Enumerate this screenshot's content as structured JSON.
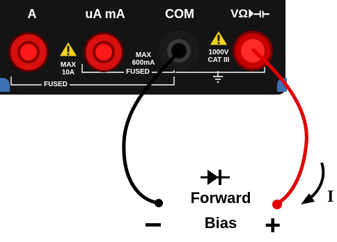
{
  "terminals": {
    "a": "A",
    "ua_ma": "uA mA",
    "com": "COM",
    "v_ohm": "VΩ⏵⊣⊢"
  },
  "ratings": {
    "a_max_line1": "MAX",
    "a_max_line2": "10A",
    "ma_max_line1": "MAX",
    "ma_max_line2": "600mA",
    "v_line1": "1000V",
    "v_line2": "CAT III"
  },
  "fused_labels": [
    "FUSED",
    "FUSED"
  ],
  "diagram": {
    "mode_line1": "Forward",
    "mode_line2": "Bias",
    "current_label": "I",
    "negative_sign": "−",
    "positive_sign": "+"
  },
  "colors": {
    "panel": "#141414",
    "probe_red": "#e00000",
    "probe_black": "#000000",
    "warning_yellow": "#f2d21b",
    "frame_blue": "#3d6fb3"
  },
  "icons": {
    "warning": "warning-triangle-icon",
    "ground": "ground-icon",
    "diode": "diode-icon",
    "current_arrow": "curved-arrow-icon"
  }
}
